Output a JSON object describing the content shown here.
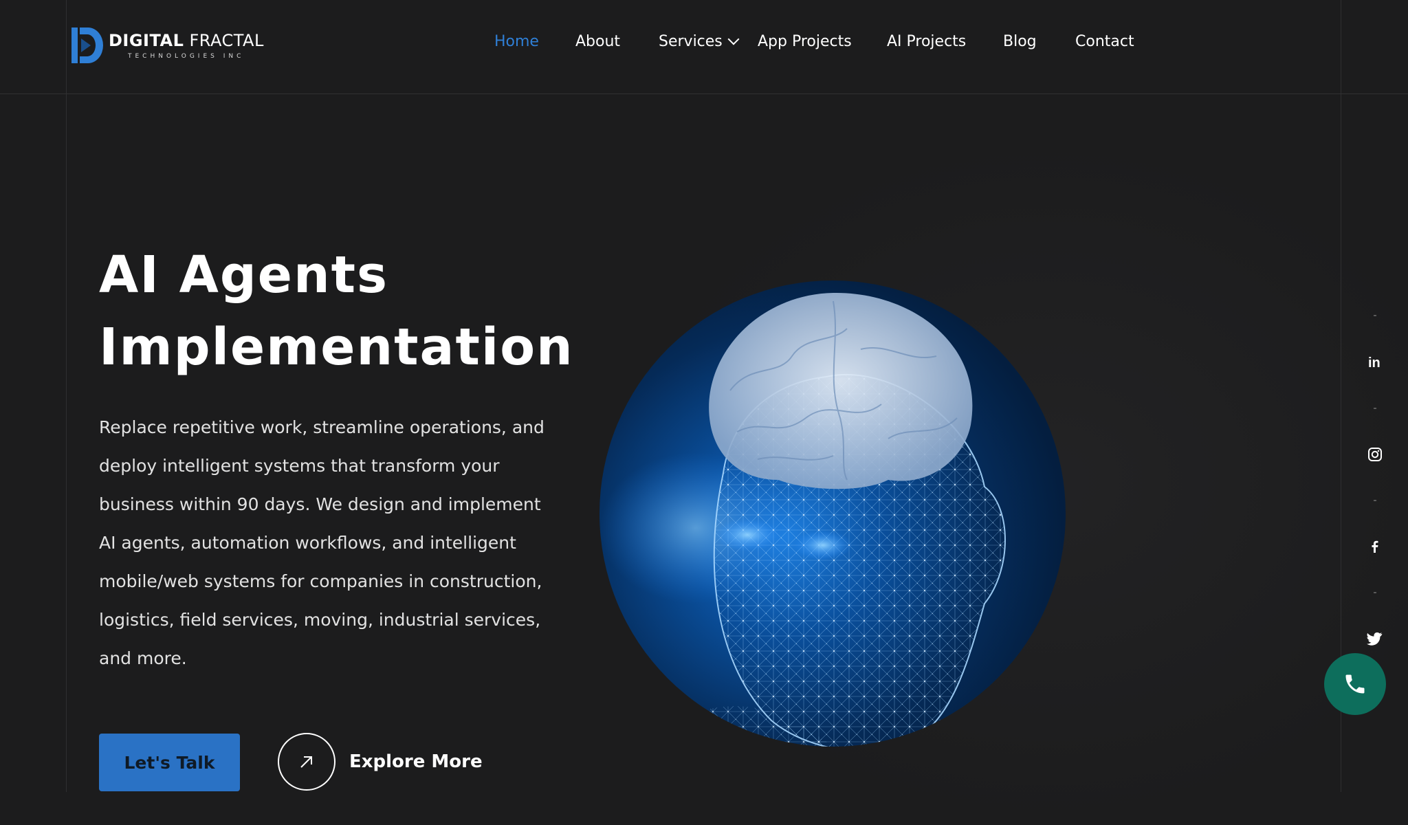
{
  "brand": {
    "name_bold": "DIGITAL",
    "name_light": "FRACTAL",
    "tagline": "TECHNOLOGIES INC",
    "accent_color": "#2f7fd6"
  },
  "nav": {
    "items": [
      {
        "label": "Home",
        "active": true
      },
      {
        "label": "About"
      },
      {
        "label": "Services",
        "has_dropdown": true
      },
      {
        "label": "App Projects"
      },
      {
        "label": "AI Projects"
      },
      {
        "label": "Blog"
      },
      {
        "label": "Contact"
      }
    ]
  },
  "hero": {
    "title_line1": "AI Agents",
    "title_line2": "Implementation",
    "description": "Replace repetitive work, streamline operations, and deploy intelligent systems that transform your business within 90 days. We design and implement AI agents, automation workflows, and intelligent mobile/web systems for companies in construction, logistics, field services, moving, industrial services, and more.",
    "primary_button": "Let's Talk",
    "secondary_button": "Explore More",
    "primary_button_color": "#2a72c5"
  },
  "social": {
    "icons": [
      "linkedin-icon",
      "instagram-icon",
      "facebook-icon",
      "twitter-icon"
    ]
  },
  "call_button": {
    "icon": "phone-icon",
    "color": "#0d6e5c"
  }
}
